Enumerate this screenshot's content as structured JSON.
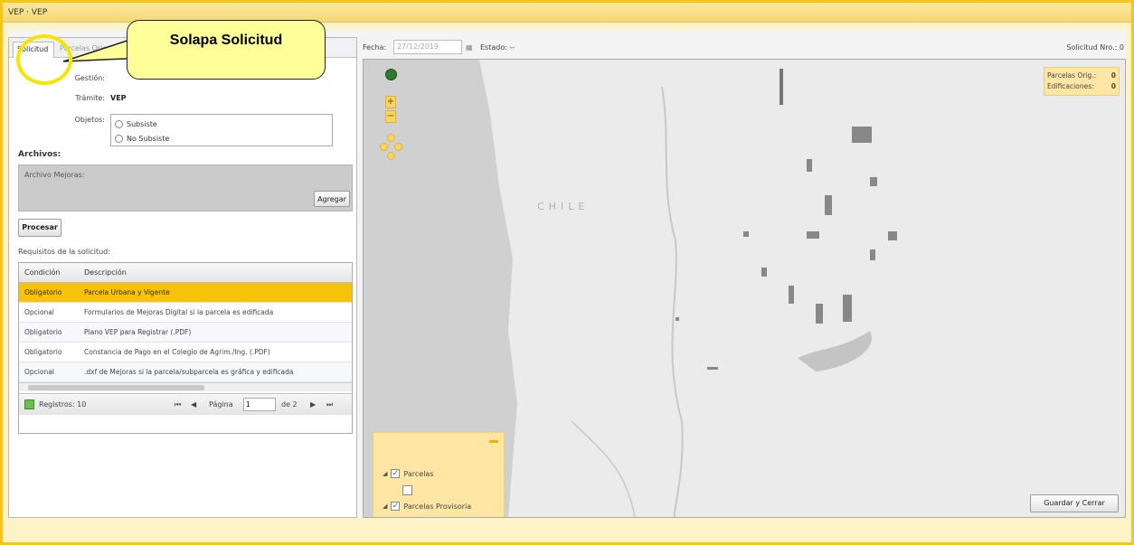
{
  "window": {
    "title": "VEP · VEP",
    "title_right": ""
  },
  "tabs": [
    {
      "label": "Solicitud"
    },
    {
      "label": "Parcelas Orig..."
    }
  ],
  "form": {
    "gestion_label": "Gestión:",
    "gestion_value": "",
    "tramite_label": "Trámite:",
    "tramite_value": "VEP",
    "objetos_label": "Objetos:",
    "objetos_options": [
      "Subsiste",
      "No Subsiste"
    ]
  },
  "archivos": {
    "title": "Archivos:",
    "file_label": "Archivo Mejoras:",
    "add_button": "Agregar"
  },
  "procesar_button": "Procesar",
  "requisitos_title": "Requisitos de la solicitud:",
  "grid": {
    "columns": [
      "Condición",
      "Descripción"
    ],
    "rows": [
      {
        "condicion": "Obligatorio",
        "descripcion": "Parcela Urbana y Vigente",
        "selected": true
      },
      {
        "condicion": "Opcional",
        "descripcion": "Formularios de Mejoras Digital si la parcela es edificada",
        "selected": false
      },
      {
        "condicion": "Obligatorio",
        "descripcion": "Plano VEP para Registrar (.PDF)",
        "selected": false
      },
      {
        "condicion": "Obligatorio",
        "descripcion": "Constancia de Pago en el Colegio de Agrim./Ing. (.PDF)",
        "selected": false
      },
      {
        "condicion": "Opcional",
        "descripcion": ".dxf de Mejoras si la parcela/subparcela es gráfica y edificada",
        "selected": false
      }
    ],
    "pager": {
      "registros": "Registros: 10",
      "pagina_label": "Página",
      "pagina_value": "1",
      "de": "de 2"
    }
  },
  "callout": {
    "text": "Solapa Solicitud"
  },
  "header": {
    "fecha_label": "Fecha:",
    "fecha_value": "27/12/2019",
    "estado_label": "Estado: --",
    "solicitud_label": "Solicitud Nro.: 0"
  },
  "map": {
    "labels": [
      "CHILE"
    ],
    "counts": [
      {
        "label": "Parcelas Orig.:",
        "value": "0"
      },
      {
        "label": "Edificaciones:",
        "value": "0"
      }
    ],
    "layers": [
      {
        "label": "Parcelas",
        "checked": true,
        "swatch": "#ffffff"
      },
      {
        "label": "Parcelas Provisoria",
        "checked": true,
        "swatch": "#9a9a9a"
      }
    ]
  },
  "footer": {
    "save_button": "Guardar y Cerrar"
  },
  "colors": {
    "accent": "#f5c518",
    "selected_row": "#f6c20a",
    "callout_bg": "#ffff99"
  }
}
